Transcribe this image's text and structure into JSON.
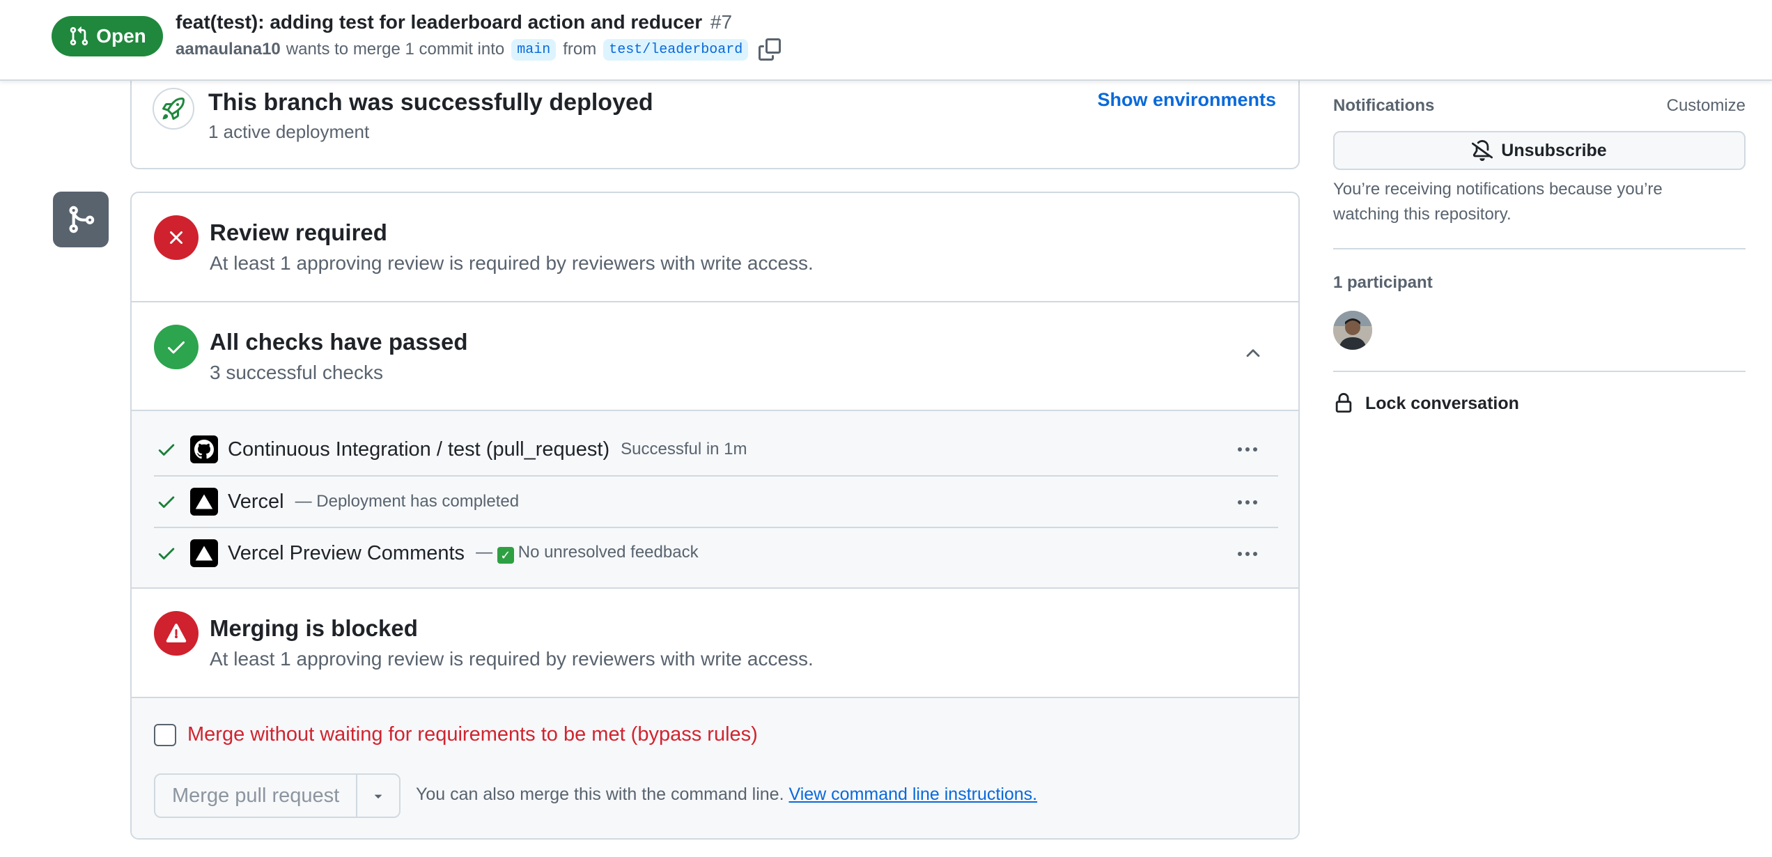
{
  "header": {
    "status_label": "Open",
    "title": "feat(test): adding test for leaderboard action and reducer",
    "number": "#7",
    "author": "aamaulana10",
    "merge_text": "wants to merge 1 commit into",
    "base_branch": "main",
    "from_text": "from",
    "head_branch": "test/leaderboard"
  },
  "deployment": {
    "title": "This branch was successfully deployed",
    "subtitle": "1 active deployment",
    "show_environments_label": "Show environments"
  },
  "review": {
    "title": "Review required",
    "subtitle": "At least 1 approving review is required by reviewers with write access."
  },
  "checks": {
    "title": "All checks have passed",
    "subtitle": "3 successful checks",
    "items": [
      {
        "name": "Continuous Integration / test (pull_request)",
        "description": "Successful in 1m",
        "logo": "github-icon"
      },
      {
        "name": "Vercel",
        "description": "— Deployment has completed",
        "logo": "vercel-icon"
      },
      {
        "name": "Vercel Preview Comments",
        "description_prefix": "—",
        "emoji": "✓",
        "description": "No unresolved feedback",
        "logo": "vercel-icon"
      }
    ]
  },
  "blocked": {
    "title": "Merging is blocked",
    "subtitle": "At least 1 approving review is required by reviewers with write access."
  },
  "merge": {
    "bypass_label": "Merge without waiting for requirements to be met (bypass rules)",
    "merge_button_label": "Merge pull request",
    "cmdline_text": "You can also merge this with the command line.",
    "cmdline_link": "View command line instructions."
  },
  "sidebar": {
    "notifications_title": "Notifications",
    "customize_label": "Customize",
    "unsubscribe_label": "Unsubscribe",
    "notifications_desc": "You’re receiving notifications because you’re watching this repository.",
    "participants_title": "1 participant",
    "lock_label": "Lock conversation"
  },
  "colors": {
    "open_green": "#1f883d",
    "danger_red": "#cf222e",
    "success_green": "#2da44e",
    "link_blue": "#0969da",
    "muted_text": "#59636e",
    "border": "#d1d9e0"
  }
}
